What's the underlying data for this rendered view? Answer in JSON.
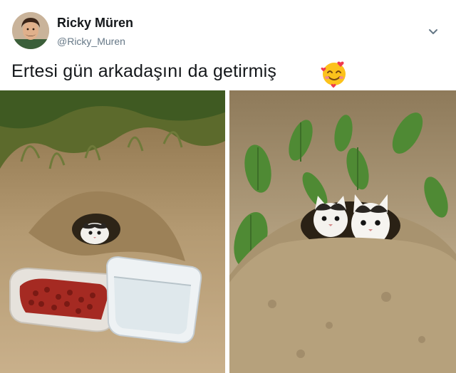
{
  "tweet": {
    "author_name": "Ricky Müren",
    "author_handle": "@Ricky_Muren",
    "text": "Ertesi gün arkadaşını da getirmiş",
    "emoji": "smiling-face-with-hearts"
  },
  "icons": {
    "menu": "chevron-down-icon",
    "avatar": "avatar-icon"
  },
  "colors": {
    "name": "#14171a",
    "handle": "#657786",
    "background": "#ffffff"
  },
  "media": {
    "photos": [
      {
        "depicts": "kitten-in-burrow-with-food-and-water"
      },
      {
        "depicts": "two-kittens-in-burrow"
      }
    ]
  }
}
